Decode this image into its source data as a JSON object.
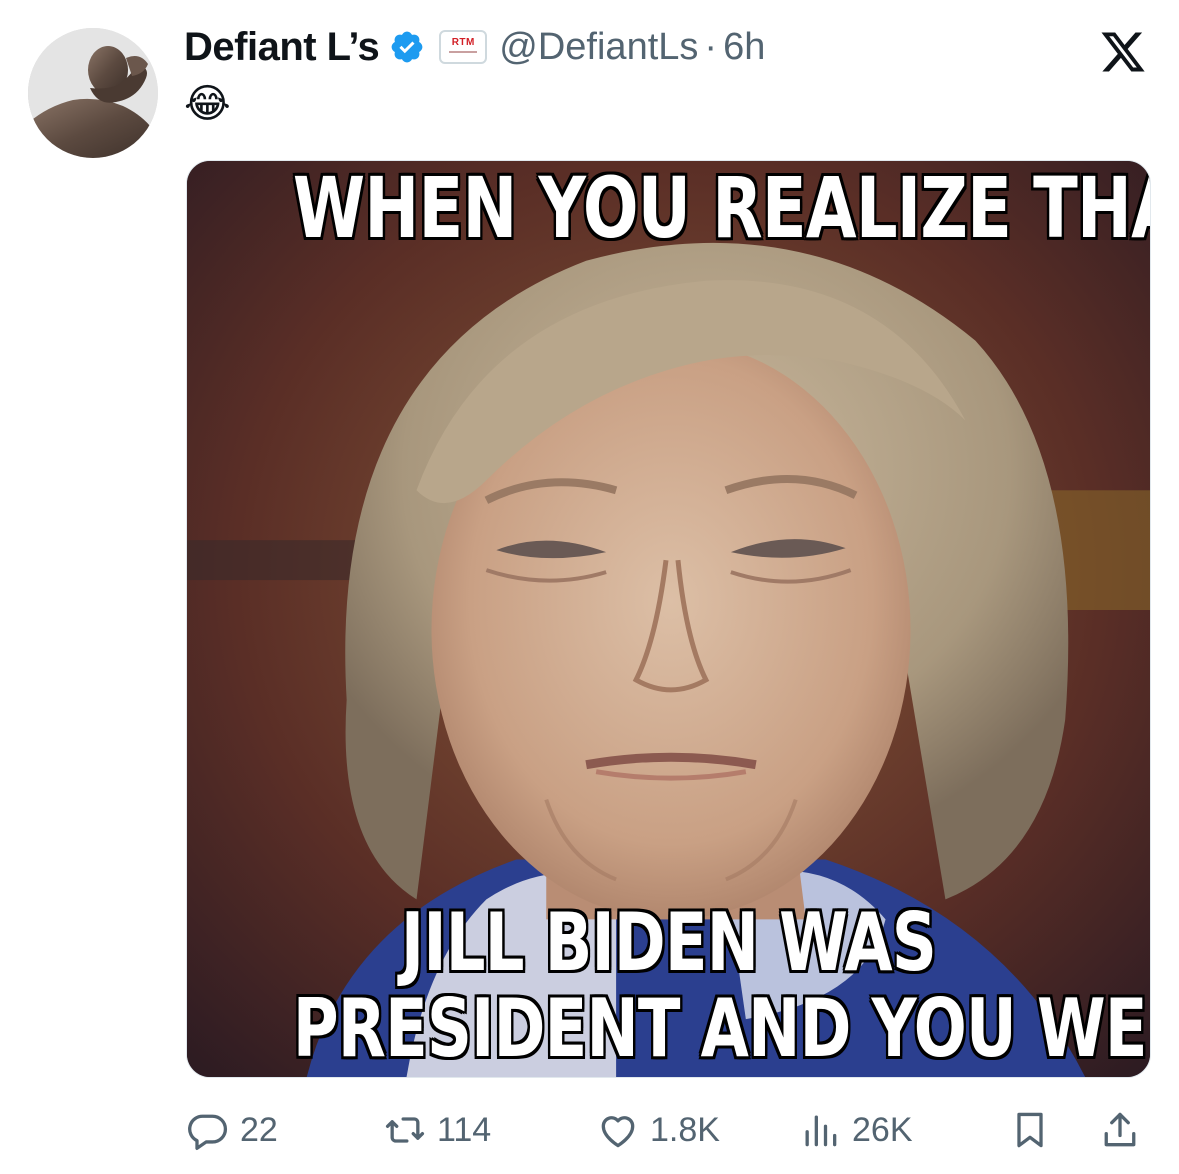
{
  "author": {
    "display_name": "Defiant L’s",
    "handle": "@DefiantLs",
    "separator": "·",
    "time": "6h",
    "affiliate_badge_text": "RTM",
    "verified_color": "#1d9bf0"
  },
  "tweet": {
    "text": "😂"
  },
  "media": {
    "caption_top": "WHEN YOU REALIZE THAT",
    "caption_bottom_line1": "JILL BIDEN WAS",
    "caption_bottom_line2": "PRESIDENT AND YOU WEREN'T"
  },
  "actions": {
    "replies": "22",
    "reposts": "114",
    "likes": "1.8K",
    "views": "26K"
  },
  "icons": {
    "close": "x-logo-icon",
    "reply": "reply-icon",
    "repost": "repost-icon",
    "like": "heart-icon",
    "views": "views-icon",
    "bookmark": "bookmark-icon",
    "share": "share-icon"
  }
}
